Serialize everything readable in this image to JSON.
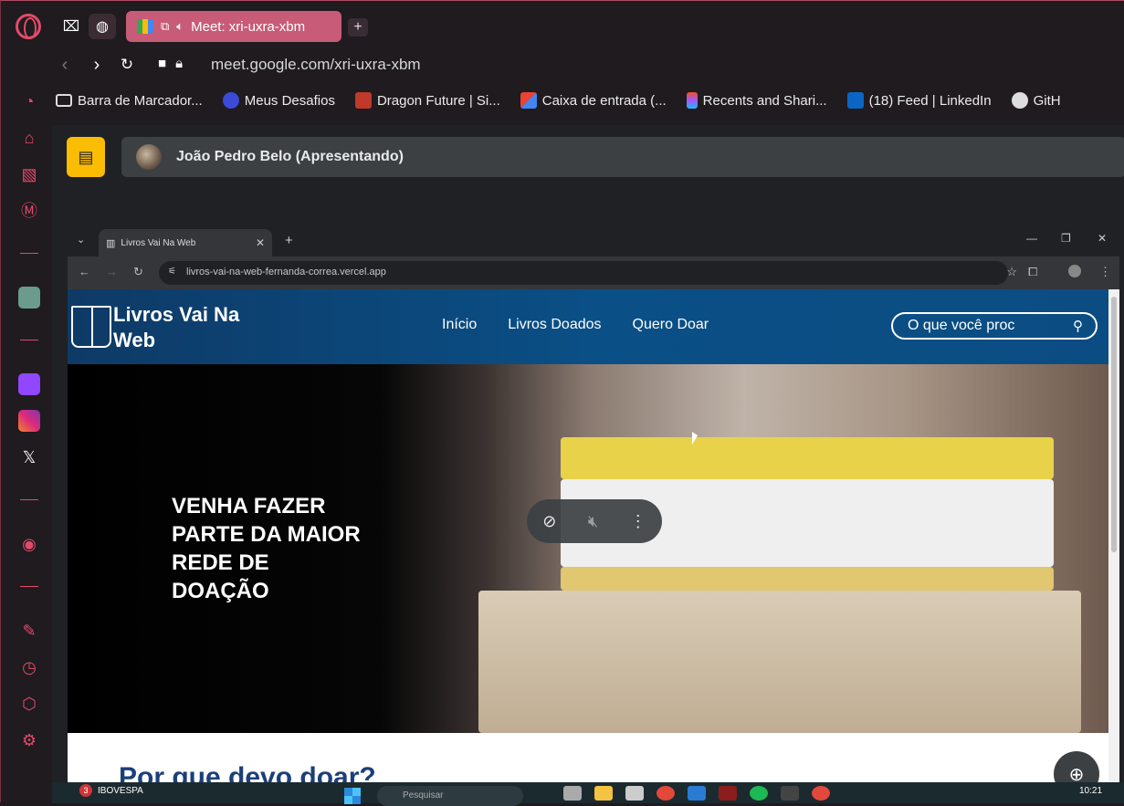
{
  "browser": {
    "active_tab_title": "Meet: xri-uxra-xbm",
    "url": "meet.google.com/xri-uxra-xbm",
    "accent_color": "#e14b6a"
  },
  "bookmarks": [
    {
      "label": "Barra de Marcador...",
      "icon": "folder-icon"
    },
    {
      "label": "Meus Desafios",
      "icon": "desafios-icon"
    },
    {
      "label": "Dragon Future | Si...",
      "icon": "dragon-future-icon"
    },
    {
      "label": "Caixa de entrada (...",
      "icon": "gmail-icon"
    },
    {
      "label": "Recents and Shari...",
      "icon": "figma-icon"
    },
    {
      "label": "(18) Feed | LinkedIn",
      "icon": "linkedin-icon"
    },
    {
      "label": "GitH",
      "icon": "github-icon"
    }
  ],
  "meet": {
    "presenter_name": "João Pedro Belo (Apresentando)"
  },
  "shared_browser": {
    "tab_title": "Livros Vai Na Web",
    "url": "livros-vai-na-web-fernanda-correa.vercel.app"
  },
  "site": {
    "logo_text": "Livros Vai Na Web",
    "nav": [
      "Início",
      "Livros Doados",
      "Quero Doar"
    ],
    "search_placeholder": "O que você proc",
    "hero_text": "VENHA FAZER PARTE DA MAIOR REDE DE DOAÇÃO",
    "section_title": "Por que devo doar?"
  },
  "taskbar": {
    "ticker": "IBOVESPA",
    "notification_count": "3",
    "search_placeholder": "Pesquisar",
    "time": "10:21"
  }
}
